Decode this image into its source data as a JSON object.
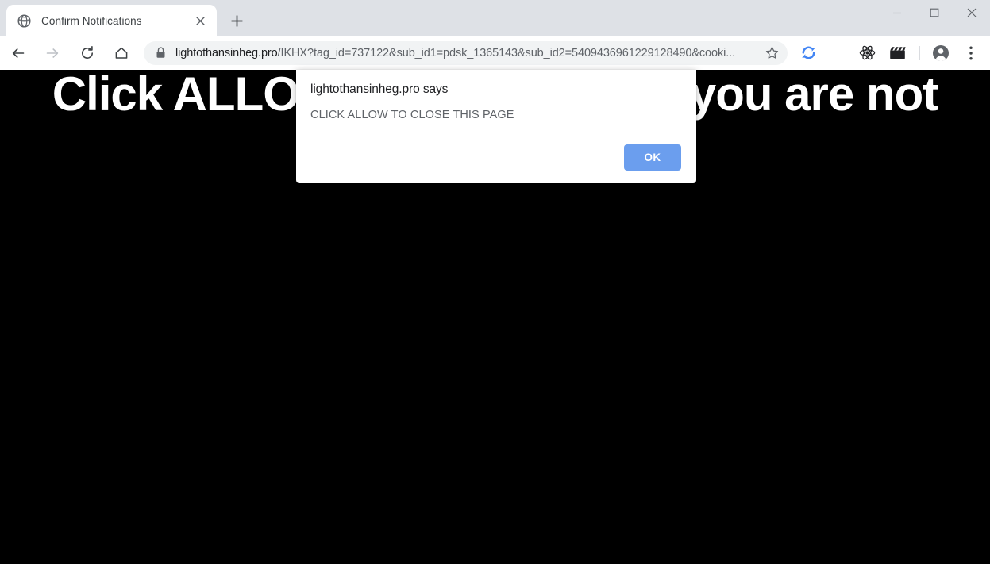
{
  "window": {
    "controls": {
      "minimize_label": "Minimize",
      "maximize_label": "Maximize",
      "close_label": "Close"
    }
  },
  "tabstrip": {
    "tabs": [
      {
        "title": "Confirm Notifications",
        "favicon": "globe-icon",
        "close_label": "Close tab",
        "active": true
      }
    ],
    "new_tab_label": "New tab"
  },
  "toolbar": {
    "back_label": "Back",
    "forward_label": "Forward",
    "reload_label": "Reload this page",
    "home_label": "Home",
    "security_icon": "lock-icon",
    "url_host": "lightothansinheg.pro",
    "url_path": "/IKHX?tag_id=737122&sub_id1=pdsk_1365143&sub_id2=5409436961229128490&cooki...",
    "url_full": "lightothansinheg.pro/IKHX?tag_id=737122&sub_id1=pdsk_1365143&sub_id2=5409436961229128490&cooki...",
    "bookmark_label": "Bookmark this tab",
    "extensions": [
      {
        "name": "sync-extension-icon",
        "label": "Sync",
        "color": "#4285f4"
      },
      {
        "name": "react-devtools-icon",
        "label": "React Developer Tools",
        "color": "#202124"
      },
      {
        "name": "video-downloader-icon",
        "label": "Video Downloader",
        "color": "#202124"
      }
    ],
    "profile_label": "Profile",
    "menu_label": "Customize and control Google Chrome"
  },
  "page": {
    "headline": "Click ALLOW to confirm that you are not",
    "background_color": "#000000",
    "text_color": "#ffffff"
  },
  "dialog": {
    "title": "lightothansinheg.pro says",
    "message": "CLICK ALLOW TO CLOSE THIS PAGE",
    "ok_label": "OK",
    "button_color": "#6b9eee"
  }
}
